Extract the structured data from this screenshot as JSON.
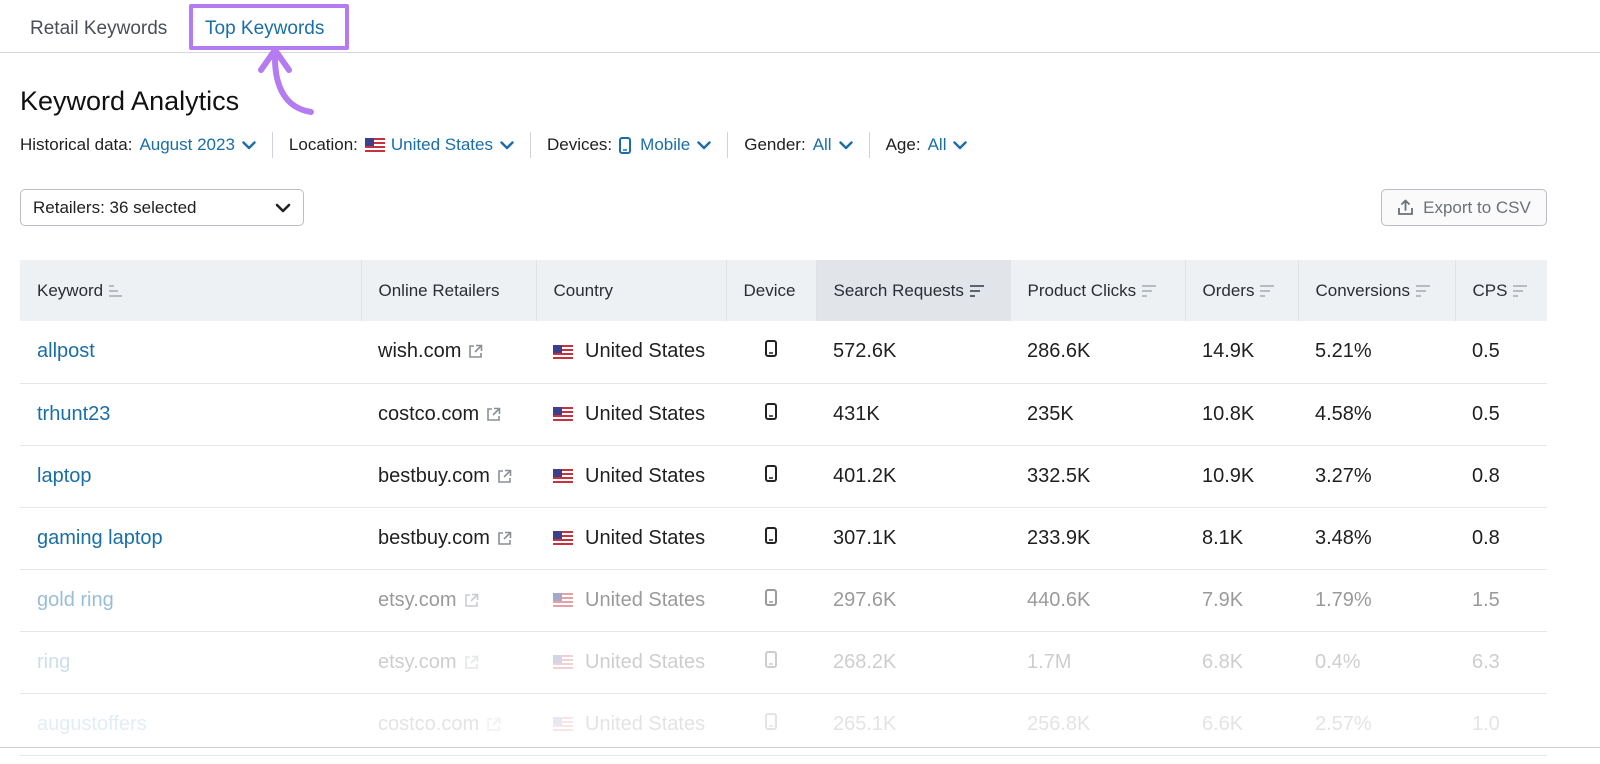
{
  "tabs": [
    {
      "label": "Retail Keywords",
      "active": false
    },
    {
      "label": "Top Keywords",
      "active": true
    }
  ],
  "highlight_color": "#b57cf2",
  "accent_color": "#1a6ea8",
  "title": "Keyword Analytics",
  "filters": {
    "historical": {
      "label": "Historical data:",
      "value": "August 2023"
    },
    "location": {
      "label": "Location:",
      "value": "United States",
      "icon": "us-flag-icon"
    },
    "devices": {
      "label": "Devices:",
      "value": "Mobile",
      "icon": "mobile-phone-icon"
    },
    "gender": {
      "label": "Gender:",
      "value": "All"
    },
    "age": {
      "label": "Age:",
      "value": "All"
    }
  },
  "retailers_select": {
    "value": "Retailers: 36 selected"
  },
  "export_button": {
    "label": "Export to CSV",
    "icon": "export-upload-icon"
  },
  "table": {
    "columns": [
      "Keyword",
      "Online Retailers",
      "Country",
      "Device",
      "Search Requests",
      "Product Clicks",
      "Orders",
      "Conversions",
      "CPS"
    ],
    "sorted_column": "Search Requests",
    "rows": [
      {
        "keyword": "allpost",
        "retailer": "wish.com",
        "country": "United States",
        "search_requests": "572.6K",
        "product_clicks": "286.6K",
        "orders": "14.9K",
        "conversions": "5.21%",
        "cps": "0.5"
      },
      {
        "keyword": "trhunt23",
        "retailer": "costco.com",
        "country": "United States",
        "search_requests": "431K",
        "product_clicks": "235K",
        "orders": "10.8K",
        "conversions": "4.58%",
        "cps": "0.5"
      },
      {
        "keyword": "laptop",
        "retailer": "bestbuy.com",
        "country": "United States",
        "search_requests": "401.2K",
        "product_clicks": "332.5K",
        "orders": "10.9K",
        "conversions": "3.27%",
        "cps": "0.8"
      },
      {
        "keyword": "gaming laptop",
        "retailer": "bestbuy.com",
        "country": "United States",
        "search_requests": "307.1K",
        "product_clicks": "233.9K",
        "orders": "8.1K",
        "conversions": "3.48%",
        "cps": "0.8"
      },
      {
        "keyword": "gold ring",
        "retailer": "etsy.com",
        "country": "United States",
        "search_requests": "297.6K",
        "product_clicks": "440.6K",
        "orders": "7.9K",
        "conversions": "1.79%",
        "cps": "1.5"
      },
      {
        "keyword": "ring",
        "retailer": "etsy.com",
        "country": "United States",
        "search_requests": "268.2K",
        "product_clicks": "1.7M",
        "orders": "6.8K",
        "conversions": "0.4%",
        "cps": "6.3"
      },
      {
        "keyword": "augustoffers",
        "retailer": "costco.com",
        "country": "United States",
        "search_requests": "265.1K",
        "product_clicks": "256.8K",
        "orders": "6.6K",
        "conversions": "2.57%",
        "cps": "1.0"
      }
    ]
  }
}
